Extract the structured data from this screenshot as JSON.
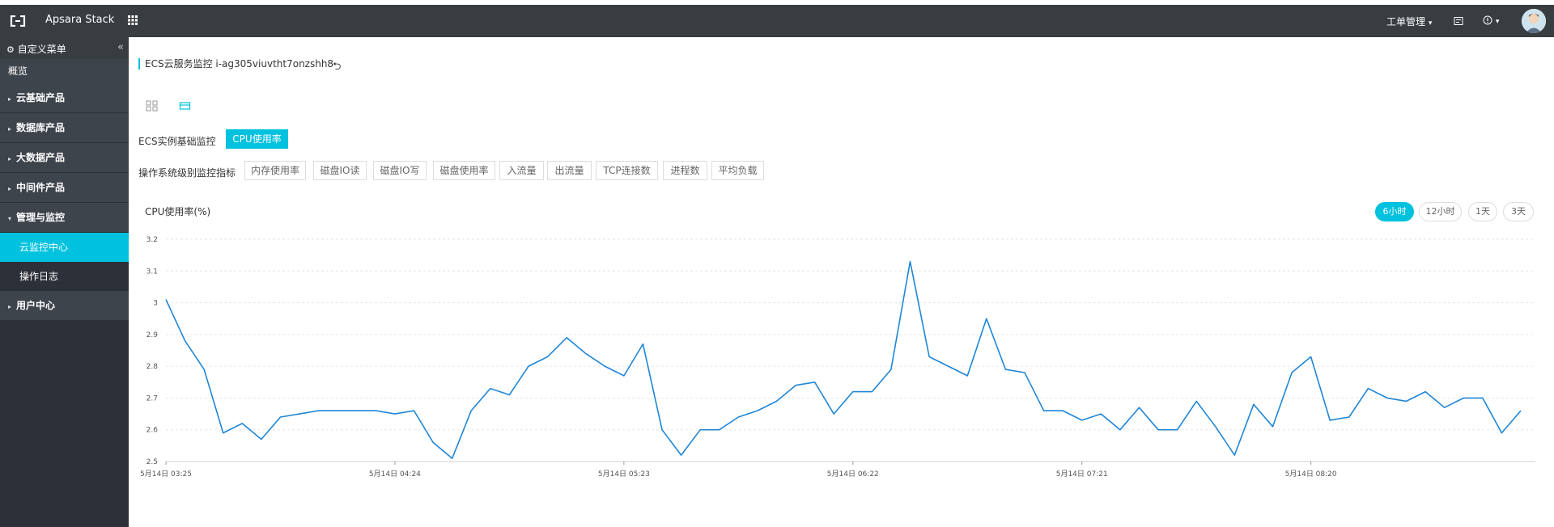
{
  "topbar": {
    "brand": "Apsara Stack",
    "ticket_label": "工单管理",
    "ticket_caret": "▾",
    "help_caret": "▾"
  },
  "sidebar": {
    "header_label": "自定义菜单",
    "overview": "概览",
    "groups": [
      {
        "label": "云基础产品"
      },
      {
        "label": "数据库产品"
      },
      {
        "label": "大数据产品"
      },
      {
        "label": "中间件产品"
      },
      {
        "label": "管理与监控"
      },
      {
        "label": "用户中心"
      }
    ],
    "subitems": [
      {
        "label": "云监控中心"
      },
      {
        "label": "操作日志"
      }
    ]
  },
  "main": {
    "title": "ECS云服务监控 i-ag305viuvtht7onzshh8",
    "basic_label": "ECS实例基础监控",
    "basic_tag": "CPU使用率",
    "os_label": "操作系统级别监控指标",
    "os_tags": [
      "内存使用率",
      "磁盘IO读",
      "磁盘IO写",
      "磁盘使用率",
      "入流量",
      "出流量",
      "TCP连接数",
      "进程数",
      "平均负载"
    ],
    "chart_title": "CPU使用率(%)",
    "ranges": [
      "6小时",
      "12小时",
      "1天",
      "3天"
    ],
    "active_range": "6小时"
  },
  "colors": {
    "accent": "#00c1de",
    "line": "#1f86d8",
    "topbar": "#373d41",
    "sidebar": "#2c3139"
  },
  "chart_data": {
    "type": "line",
    "title": "CPU使用率(%)",
    "ylim": [
      2.5,
      3.2
    ],
    "yticks": [
      "3.2",
      "3.1",
      "3",
      "2.9",
      "2.8",
      "2.7",
      "2.6",
      "2.5"
    ],
    "ytick_values": [
      3.2,
      3.1,
      3.0,
      2.9,
      2.8,
      2.7,
      2.6,
      2.5
    ],
    "xtick_labels": [
      "5月14日 03:25",
      "5月14日 04:24",
      "5月14日 05:23",
      "5月14日 06:22",
      "5月14日 07:21",
      "5月14日 08:20"
    ],
    "xtick_indices": [
      0,
      12,
      24,
      36,
      48,
      60
    ],
    "grid": true,
    "series": [
      {
        "values": [
          3.01,
          2.88,
          2.79,
          2.59,
          2.62,
          2.57,
          2.64,
          2.65,
          2.66,
          2.66,
          2.66,
          2.66,
          2.65,
          2.66,
          2.56,
          2.51,
          2.66,
          2.73,
          2.71,
          2.8,
          2.83,
          2.89,
          2.84,
          2.8,
          2.77,
          2.87,
          2.6,
          2.52,
          2.6,
          2.6,
          2.64,
          2.66,
          2.69,
          2.74,
          2.75,
          2.65,
          2.72,
          2.72,
          2.79,
          3.13,
          2.83,
          2.8,
          2.77,
          2.95,
          2.79,
          2.78,
          2.66,
          2.66,
          2.63,
          2.65,
          2.6,
          2.67,
          2.6,
          2.6,
          2.69,
          2.61,
          2.52,
          2.68,
          2.61,
          2.78,
          2.83,
          2.63,
          2.64,
          2.73,
          2.7,
          2.69,
          2.72,
          2.67,
          2.7,
          2.7,
          2.59,
          2.66
        ]
      }
    ]
  }
}
